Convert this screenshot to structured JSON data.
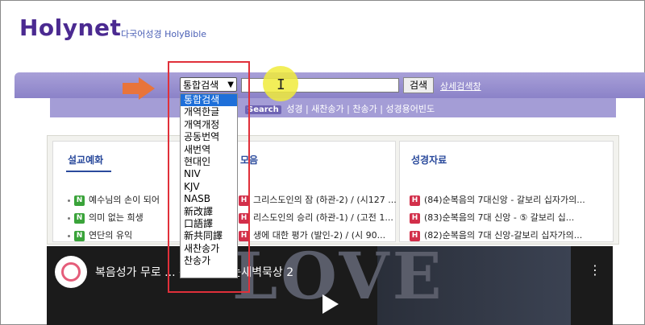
{
  "app": {
    "logo": "Holynet",
    "subtitle": "다국어성경 HolyBible"
  },
  "search": {
    "selected": "통합검색",
    "button": "검색",
    "advanced": "상세검색창",
    "options": [
      "통합검색",
      "개역한글",
      "개역개정",
      "공동번역",
      "새번역",
      "현대인",
      "NIV",
      "KJV",
      "NASB",
      "新改譯",
      "口語譯",
      "新共同譯",
      "새찬송가",
      "찬송가"
    ]
  },
  "subnav": {
    "badge": "Search",
    "links": "성경 | 새찬송가 | 찬송가 | 성경용어빈도"
  },
  "panels": {
    "sermon": {
      "title": "설교예화",
      "items": [
        {
          "tag": "N",
          "text": "예수님의 손이 되어"
        },
        {
          "tag": "N",
          "text": "의미 없는 희생"
        },
        {
          "tag": "N",
          "text": "연단의 유익"
        }
      ]
    },
    "middle": {
      "title": "모음",
      "items": [
        {
          "tag": "H",
          "text": "그리스도인의 잠 (하관-2) / (시127 ..."
        },
        {
          "tag": "H",
          "text": "리스도인의 승리 (하관-1) / (고전 1..."
        },
        {
          "tag": "H",
          "text": "생에 대한 평가 (발인-2) / (시 90..."
        }
      ]
    },
    "bible": {
      "title": "성경자료",
      "items": [
        {
          "tag": "H",
          "text": "(84)순복음의 7대신앙 - 갈보리 십자가의..."
        },
        {
          "tag": "H",
          "text": "(83)순복음의 7대 신앙 - ⑤ 갈보리 십..."
        },
        {
          "tag": "H",
          "text": "(82)순복음의 7대 신앙-갈보리 십자가의..."
        }
      ]
    }
  },
  "video": {
    "title": "복음성가 무로 ... 편과함께하는새벽묵상 2",
    "overlay": "LOVE"
  },
  "colors": {
    "accent": "#4b2a91",
    "bar": "#9a92d2",
    "highlight": "#1e6fd9",
    "annotation": "#e0303a"
  }
}
